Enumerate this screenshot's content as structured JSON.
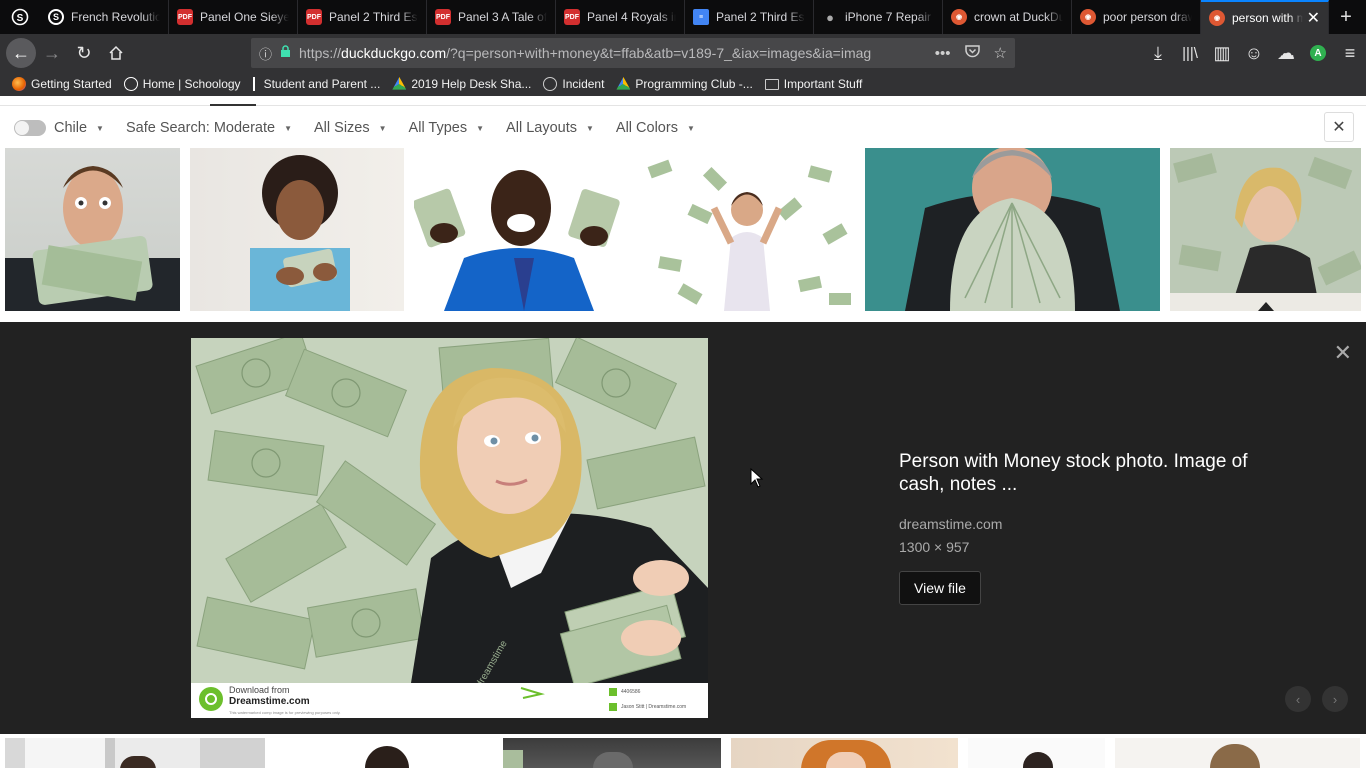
{
  "browser": {
    "tabs": [
      {
        "title": "French Revolutio",
        "icon": "schoology-icon",
        "active": false
      },
      {
        "title": "Panel One Sieyes",
        "icon": "pdf-icon",
        "active": false
      },
      {
        "title": "Panel 2 Third Est",
        "icon": "pdf-icon",
        "active": false
      },
      {
        "title": "Panel 3 A Tale of",
        "icon": "pdf-icon",
        "active": false
      },
      {
        "title": "Panel 4 Royals in",
        "icon": "pdf-icon",
        "active": false
      },
      {
        "title": "Panel 2 Third Est",
        "icon": "google-docs-icon",
        "active": false
      },
      {
        "title": "iPhone 7 Repair",
        "icon": "apple-icon",
        "active": false
      },
      {
        "title": "crown at DuckDu",
        "icon": "duckduckgo-icon",
        "active": false
      },
      {
        "title": "poor person draw",
        "icon": "duckduckgo-icon",
        "active": false
      },
      {
        "title": "person with m",
        "icon": "duckduckgo-icon",
        "active": true
      }
    ],
    "url_prefix": "https://",
    "url_host": "duckduckgo.com",
    "url_rest": "/?q=person+with+money&t=ffab&atb=v189-7_&iax=images&ia=imag",
    "profile_initial": "A",
    "bookmarks": [
      {
        "label": "Getting Started",
        "icon": "firefox-icon"
      },
      {
        "label": "Home | Schoology",
        "icon": "schoology-icon"
      },
      {
        "label": "Student and Parent ...",
        "icon": "powerschool-icon"
      },
      {
        "label": "2019 Help Desk Sha...",
        "icon": "google-drive-icon"
      },
      {
        "label": "Incident",
        "icon": "globe-icon"
      },
      {
        "label": "Programming Club -...",
        "icon": "google-drive-icon"
      },
      {
        "label": "Important Stuff",
        "icon": "folder-icon"
      }
    ]
  },
  "filters": {
    "region": "Chile",
    "safe_search": "Safe Search: Moderate",
    "sizes": "All Sizes",
    "types": "All Types",
    "layouts": "All Layouts",
    "colors": "All Colors"
  },
  "detail": {
    "title": "Person with Money stock photo. Image of cash, notes ...",
    "source": "dreamstime.com",
    "dimensions": "1300 × 957",
    "view_button": "View file",
    "watermark_line1": "Download from",
    "watermark_line2": "Dreamstime.com",
    "watermark_small": "This watermarked comp image is for previewing purposes only.",
    "watermark_id": "4406586",
    "watermark_credit": "Jason Stitt | Dreamstime.com",
    "image_watermark": "dreamstime"
  },
  "colors": {
    "accent": "#0a84ff",
    "detail_bg": "#222222",
    "money_green": "#9fbf8e"
  }
}
